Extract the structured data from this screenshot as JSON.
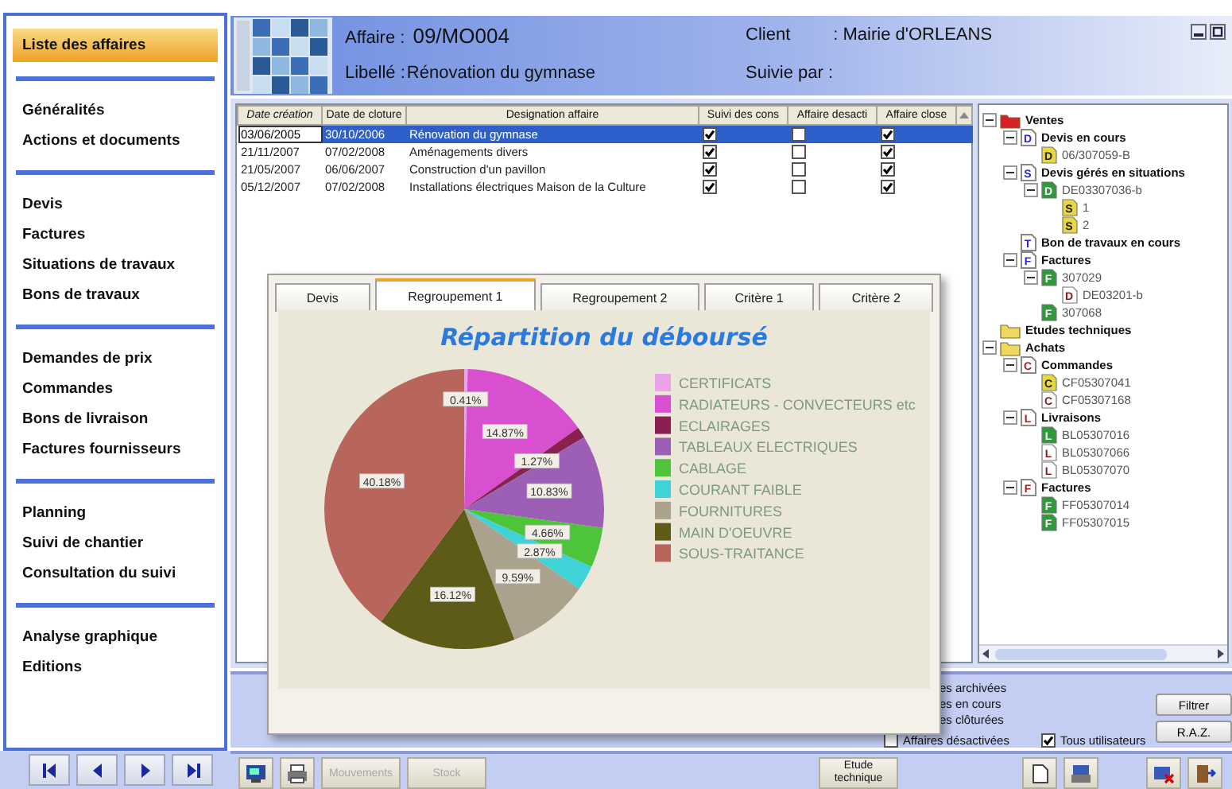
{
  "sidebar": {
    "groups": [
      {
        "items": [
          {
            "label": "Liste des affaires",
            "selected": true
          }
        ]
      },
      {
        "items": [
          {
            "label": "Généralités",
            "selected": false
          },
          {
            "label": "Actions et documents",
            "selected": false
          }
        ]
      },
      {
        "items": [
          {
            "label": "Devis",
            "selected": false
          },
          {
            "label": "Factures",
            "selected": false
          },
          {
            "label": "Situations de travaux",
            "selected": false
          },
          {
            "label": "Bons de travaux",
            "selected": false
          }
        ]
      },
      {
        "items": [
          {
            "label": "Demandes de prix",
            "selected": false
          },
          {
            "label": "Commandes",
            "selected": false
          },
          {
            "label": "Bons de livraison",
            "selected": false
          },
          {
            "label": "Factures fournisseurs",
            "selected": false
          }
        ]
      },
      {
        "items": [
          {
            "label": "Planning",
            "selected": false
          },
          {
            "label": "Suivi de chantier",
            "selected": false
          },
          {
            "label": "Consultation du suivi",
            "selected": false
          }
        ]
      },
      {
        "items": [
          {
            "label": "Analyse graphique",
            "selected": false
          },
          {
            "label": "Editions",
            "selected": false
          }
        ]
      }
    ]
  },
  "header": {
    "affaire_label": "Affaire :",
    "affaire": "09/MO004",
    "libelle_label": "Libellé :",
    "libelle": "Rénovation du gymnase",
    "client_label": "Client",
    "client": ": Mairie d'ORLEANS",
    "suivie_label": "Suivie par :"
  },
  "table": {
    "columns": [
      "Date création",
      "Date de cloture",
      "Designation affaire",
      "Suivi des cons",
      "Affaire desacti",
      "Affaire close"
    ],
    "rows": [
      {
        "date_creation": "03/06/2005",
        "date_cloture": "30/10/2006",
        "designation": "Rénovation du gymnase",
        "suivi": true,
        "desactivee": false,
        "close": true,
        "selected": true
      },
      {
        "date_creation": "21/11/2007",
        "date_cloture": "07/02/2008",
        "designation": "Aménagements divers",
        "suivi": true,
        "desactivee": false,
        "close": true,
        "selected": false
      },
      {
        "date_creation": "21/05/2007",
        "date_cloture": "06/06/2007",
        "designation": "Construction d'un pavillon",
        "suivi": true,
        "desactivee": false,
        "close": true,
        "selected": false
      },
      {
        "date_creation": "05/12/2007",
        "date_cloture": "07/02/2008",
        "designation": "Installations électriques Maison de la Culture",
        "suivi": true,
        "desactivee": false,
        "close": true,
        "selected": false
      }
    ]
  },
  "tree": [
    {
      "label": "Ventes",
      "kind": "folder",
      "color": "#d8202a",
      "expanded": true,
      "children": [
        {
          "label": "Devis en cours",
          "kind": "category",
          "letter": "D",
          "color": "#2a2ad0",
          "expanded": true,
          "children": [
            {
              "label": "06/307059-B",
              "kind": "document",
              "letter": "D",
              "color": "#e8d840"
            }
          ]
        },
        {
          "label": "Devis gérés en situations",
          "kind": "category",
          "letter": "S",
          "color": "#2a2ad0",
          "expanded": true,
          "children": [
            {
              "label": "DE03307036-b",
              "kind": "document",
              "letter": "D",
              "color": "#2f9a3a",
              "expanded": true,
              "children": [
                {
                  "label": "1",
                  "kind": "document",
                  "letter": "S",
                  "color": "#e8d840"
                },
                {
                  "label": "2",
                  "kind": "document",
                  "letter": "S",
                  "color": "#e8d840"
                }
              ]
            }
          ]
        },
        {
          "label": "Bon de travaux en cours",
          "kind": "category",
          "letter": "T",
          "color": "#2a2ad0"
        },
        {
          "label": "Factures",
          "kind": "category",
          "letter": "F",
          "color": "#2a2ad0",
          "expanded": true,
          "children": [
            {
              "label": "307029",
              "kind": "document",
              "letter": "F",
              "color": "#2f9a3a",
              "expanded": true,
              "children": [
                {
                  "label": "DE03201-b",
                  "kind": "document",
                  "letter": "D",
                  "color": "#ffffff"
                }
              ]
            },
            {
              "label": "307068",
              "kind": "document",
              "letter": "F",
              "color": "#2f9a3a"
            }
          ]
        }
      ]
    },
    {
      "label": "Etudes techniques",
      "kind": "folder",
      "color": "#f0d860"
    },
    {
      "label": "Achats",
      "kind": "folder",
      "color": "#f0d860",
      "expanded": true,
      "children": [
        {
          "label": "Commandes",
          "kind": "category",
          "letter": "C",
          "color": "#b02020",
          "expanded": true,
          "children": [
            {
              "label": "CF05307041",
              "kind": "document",
              "letter": "C",
              "color": "#e8d840"
            },
            {
              "label": "CF05307168",
              "kind": "document",
              "letter": "C",
              "color": "#ffffff"
            }
          ]
        },
        {
          "label": "Livraisons",
          "kind": "category",
          "letter": "L",
          "color": "#b02020",
          "expanded": true,
          "children": [
            {
              "label": "BL05307016",
              "kind": "document",
              "letter": "L",
              "color": "#2f9a3a"
            },
            {
              "label": "BL05307066",
              "kind": "document",
              "letter": "L",
              "color": "#ffffff"
            },
            {
              "label": "BL05307070",
              "kind": "document",
              "letter": "L",
              "color": "#ffffff"
            }
          ]
        },
        {
          "label": "Factures",
          "kind": "category",
          "letter": "F",
          "color": "#b02020",
          "expanded": true,
          "children": [
            {
              "label": "FF05307014",
              "kind": "document",
              "letter": "F",
              "color": "#2f9a3a"
            },
            {
              "label": "FF05307015",
              "kind": "document",
              "letter": "F",
              "color": "#2f9a3a"
            }
          ]
        }
      ]
    }
  ],
  "filter": {
    "options": [
      "es archivées",
      "es en cours",
      "es clôturées"
    ],
    "checkboxes": [
      {
        "label": "Affaires désactivées",
        "checked": false
      },
      {
        "label": "Tous utilisateurs",
        "checked": true
      }
    ],
    "buttons": [
      "Filtrer",
      "R.A.Z."
    ]
  },
  "toolbar": {
    "buttons": [
      {
        "label": "Mouvements",
        "disabled": true
      },
      {
        "label": "Stock",
        "disabled": true
      },
      {
        "label": "Etude technique",
        "disabled": false
      }
    ]
  },
  "popup": {
    "tabs": [
      {
        "label": "Devis",
        "selected": false
      },
      {
        "label": "Regroupement 1",
        "selected": true
      },
      {
        "label": "Regroupement 2",
        "selected": false
      },
      {
        "label": "Critère 1",
        "selected": false
      },
      {
        "label": "Critère 2",
        "selected": false
      }
    ],
    "chart_data": {
      "type": "pie",
      "title": "Répartition du déboursé",
      "categories": [
        "CERTIFICATS",
        "RADIATEURS - CONVECTEURS etc",
        "ECLAIRAGES",
        "TABLEAUX ELECTRIQUES",
        "CABLAGE",
        "COURANT FAIBLE",
        "FOURNITURES",
        "MAIN D'OEUVRE",
        "SOUS-TRAITANCE"
      ],
      "values": [
        0.41,
        14.87,
        1.27,
        10.83,
        4.66,
        2.87,
        9.59,
        16.12,
        40.18
      ],
      "colors": [
        "#e9a3e6",
        "#d84fd0",
        "#8a2050",
        "#9d5fb5",
        "#4ec43a",
        "#3fd3d8",
        "#aaa28c",
        "#5e5a18",
        "#b8665c"
      ],
      "legend": true,
      "value_labels": [
        "0.41%",
        "14.87%",
        "1.27%",
        "10.83%",
        "4.66%",
        "2.87%",
        "9.59%",
        "16.12%",
        "40.18%"
      ]
    }
  }
}
